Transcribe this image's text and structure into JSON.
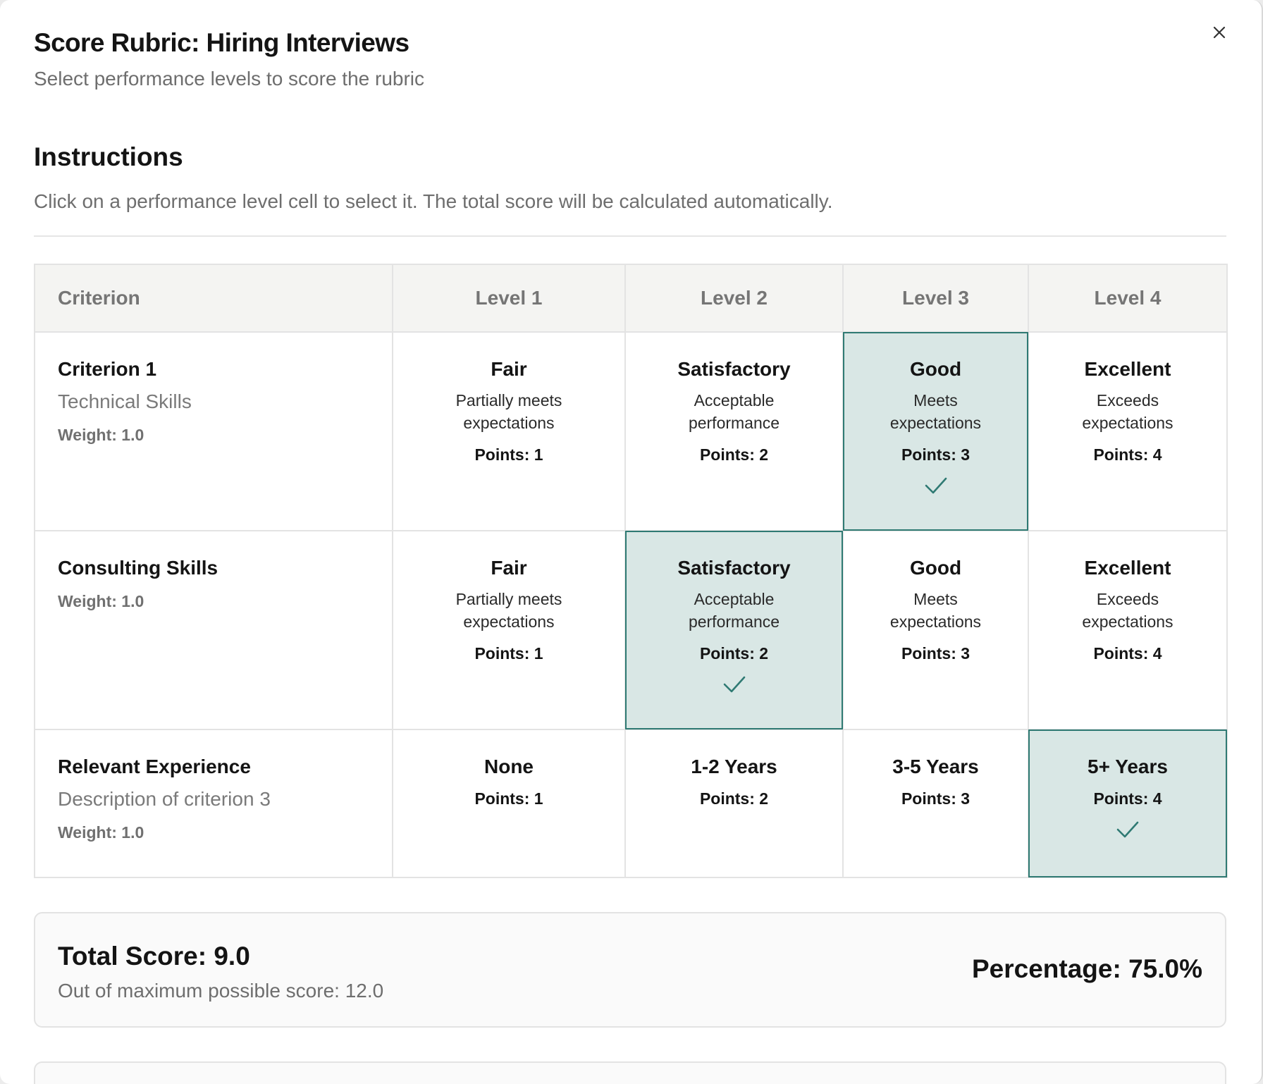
{
  "dialog": {
    "title": "Score Rubric: Hiring Interviews",
    "subtitle": "Select performance levels to score the rubric",
    "close_icon": "close-icon"
  },
  "instructions": {
    "heading": "Instructions",
    "text": "Click on a performance level cell to select it. The total score will be calculated automatically."
  },
  "table": {
    "headers": [
      "Criterion",
      "Level 1",
      "Level 2",
      "Level 3",
      "Level 4"
    ],
    "rows": [
      {
        "name": "Criterion 1",
        "description": "Technical Skills",
        "weight": "Weight: 1.0",
        "levels": [
          {
            "name": "Fair",
            "desc1": "Partially meets",
            "desc2": "expectations",
            "points": "Points: 1"
          },
          {
            "name": "Satisfactory",
            "desc1": "Acceptable",
            "desc2": "performance",
            "points": "Points: 2"
          },
          {
            "name": "Good",
            "desc1": "Meets",
            "desc2": "expectations",
            "points": "Points: 3"
          },
          {
            "name": "Excellent",
            "desc1": "Exceeds",
            "desc2": "expectations",
            "points": "Points: 4"
          }
        ],
        "selected_level": 3
      },
      {
        "name": "Consulting Skills",
        "description": "",
        "weight": "Weight: 1.0",
        "levels": [
          {
            "name": "Fair",
            "desc1": "Partially meets",
            "desc2": "expectations",
            "points": "Points: 1"
          },
          {
            "name": "Satisfactory",
            "desc1": "Acceptable",
            "desc2": "performance",
            "points": "Points: 2"
          },
          {
            "name": "Good",
            "desc1": "Meets",
            "desc2": "expectations",
            "points": "Points: 3"
          },
          {
            "name": "Excellent",
            "desc1": "Exceeds",
            "desc2": "expectations",
            "points": "Points: 4"
          }
        ],
        "selected_level": 2
      },
      {
        "name": "Relevant Experience",
        "description": "Description of criterion 3",
        "weight": "Weight: 1.0",
        "levels": [
          {
            "name": "None",
            "points": "Points: 1"
          },
          {
            "name": "1-2 Years",
            "points": "Points: 2"
          },
          {
            "name": "3-5 Years",
            "points": "Points: 3"
          },
          {
            "name": "5+ Years",
            "points": "Points: 4"
          }
        ],
        "selected_level": 4
      }
    ]
  },
  "summary": {
    "total": "Total Score: 9.0",
    "max": "Out of maximum possible score: 12.0",
    "percentage": "Percentage: 75.0%"
  },
  "colors": {
    "selected_bg": "#d9e7e5",
    "selected_border": "#2f7a73",
    "check": "#2f7a73"
  }
}
